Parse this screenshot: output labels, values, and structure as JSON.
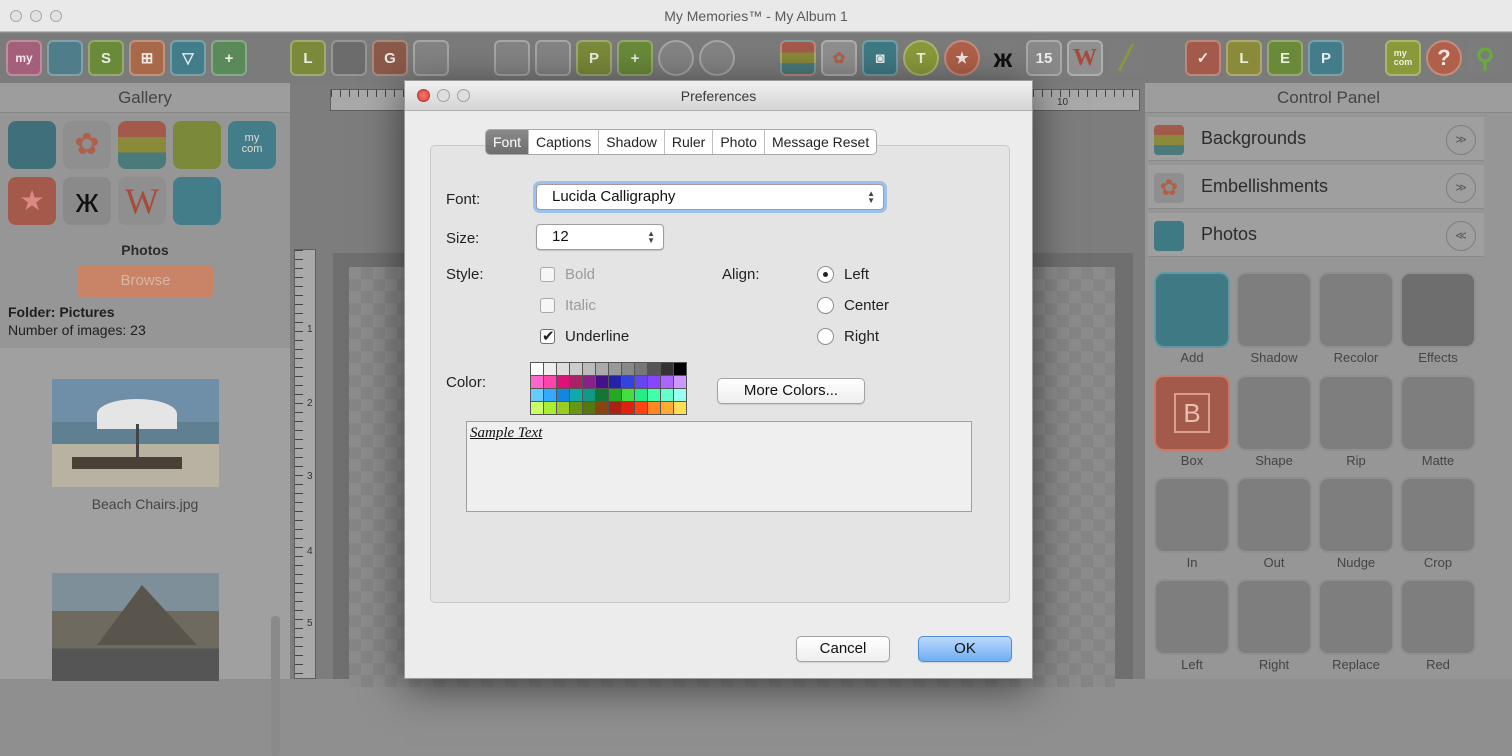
{
  "window": {
    "title": "My Memories™ - My Album 1"
  },
  "toolbar": {
    "icons": [
      "mycom-logo-icon",
      "folder-icon",
      "s-icon",
      "layout-icon",
      "shield-icon",
      "add-page-icon",
      "l-icon",
      "film-icon",
      "g-icon",
      "blank-icon",
      "blank2-icon",
      "blank3-icon",
      "p-icon",
      "plus-page-icon",
      "blank4-icon",
      "blank5-icon",
      "backgrounds-icon",
      "embellishments-icon",
      "camera-icon",
      "text-icon",
      "star-icon",
      "butterfly-icon",
      "calendar-icon",
      "wordart-icon",
      "brush-icon",
      "check-icon",
      "l2-icon",
      "e-icon",
      "p2-icon",
      "mycom-icon",
      "help-icon",
      "search-icon"
    ],
    "calendar_text": "15",
    "wordart_text": "W",
    "mycom_text": "my\ncom",
    "help_text": "?"
  },
  "gallery": {
    "title": "Gallery",
    "icons": [
      "camera-icon",
      "flower-icon",
      "stripes-icon",
      "layout-l-icon",
      "mycom-icon",
      "star-icon",
      "butterfly-icon",
      "wordart-w-icon",
      "frame-icon"
    ],
    "mycom_text": "my\ncom",
    "w_text": "W",
    "photos_title": "Photos",
    "browse_label": "Browse",
    "folder_label": "Folder: Pictures",
    "count_label": "Number of images: 23",
    "thumbs": [
      {
        "label": "Beach Chairs.jpg"
      },
      {
        "label": ""
      }
    ]
  },
  "ruler": {
    "h_labels": [
      "10"
    ],
    "v_labels": [
      "1",
      "2",
      "3",
      "4",
      "5"
    ]
  },
  "control_panel": {
    "title": "Control Panel",
    "sections": [
      {
        "label": "Backgrounds",
        "chevron": "≫",
        "icon": "backgrounds-icon"
      },
      {
        "label": "Embellishments",
        "chevron": "≫",
        "icon": "embellishments-icon"
      },
      {
        "label": "Photos",
        "chevron": "≪",
        "icon": "photos-icon"
      }
    ],
    "tools": [
      {
        "label": "Add"
      },
      {
        "label": "Shadow"
      },
      {
        "label": "Recolor"
      },
      {
        "label": "Effects"
      },
      {
        "label": "Box"
      },
      {
        "label": "Shape"
      },
      {
        "label": "Rip"
      },
      {
        "label": "Matte"
      },
      {
        "label": "In"
      },
      {
        "label": "Out"
      },
      {
        "label": "Nudge"
      },
      {
        "label": "Crop"
      },
      {
        "label": "Left"
      },
      {
        "label": "Right"
      },
      {
        "label": "Replace"
      },
      {
        "label": "Red"
      }
    ],
    "box_glyph": "B"
  },
  "dialog": {
    "title": "Preferences",
    "tabs": [
      "Font",
      "Captions",
      "Shadow",
      "Ruler",
      "Photo",
      "Message Reset"
    ],
    "selected_tab": "Font",
    "font_label": "Font:",
    "font_value": "Lucida Calligraphy",
    "size_label": "Size:",
    "size_value": "12",
    "style_label": "Style:",
    "styles": [
      {
        "label": "Bold",
        "checked": false,
        "enabled": false
      },
      {
        "label": "Italic",
        "checked": false,
        "enabled": false
      },
      {
        "label": "Underline",
        "checked": true,
        "enabled": true
      }
    ],
    "align_label": "Align:",
    "aligns": [
      {
        "label": "Left",
        "selected": true
      },
      {
        "label": "Center",
        "selected": false
      },
      {
        "label": "Right",
        "selected": false
      }
    ],
    "color_label": "Color:",
    "palette": [
      "#ffffff",
      "#eeeeee",
      "#dddddd",
      "#cccccc",
      "#bbbbbb",
      "#aaaaaa",
      "#999999",
      "#888888",
      "#777777",
      "#555555",
      "#333333",
      "#000000",
      "#ff66cc",
      "#ff44aa",
      "#dd1177",
      "#aa2266",
      "#882288",
      "#441188",
      "#2222aa",
      "#3344dd",
      "#6644ee",
      "#8844ff",
      "#aa66ff",
      "#cc99ff",
      "#66ccff",
      "#33aaff",
      "#1188dd",
      "#11aaaa",
      "#119988",
      "#117733",
      "#22aa22",
      "#44dd44",
      "#22ee88",
      "#44ffaa",
      "#66ffcc",
      "#99ffee",
      "#ccff66",
      "#aaee33",
      "#99cc22",
      "#669911",
      "#557711",
      "#884411",
      "#aa2211",
      "#dd2211",
      "#ff4411",
      "#ff8822",
      "#ffaa33",
      "#ffdd55"
    ],
    "more_colors_label": "More Colors...",
    "sample_text": "Sample Text",
    "cancel_label": "Cancel",
    "ok_label": "OK"
  }
}
